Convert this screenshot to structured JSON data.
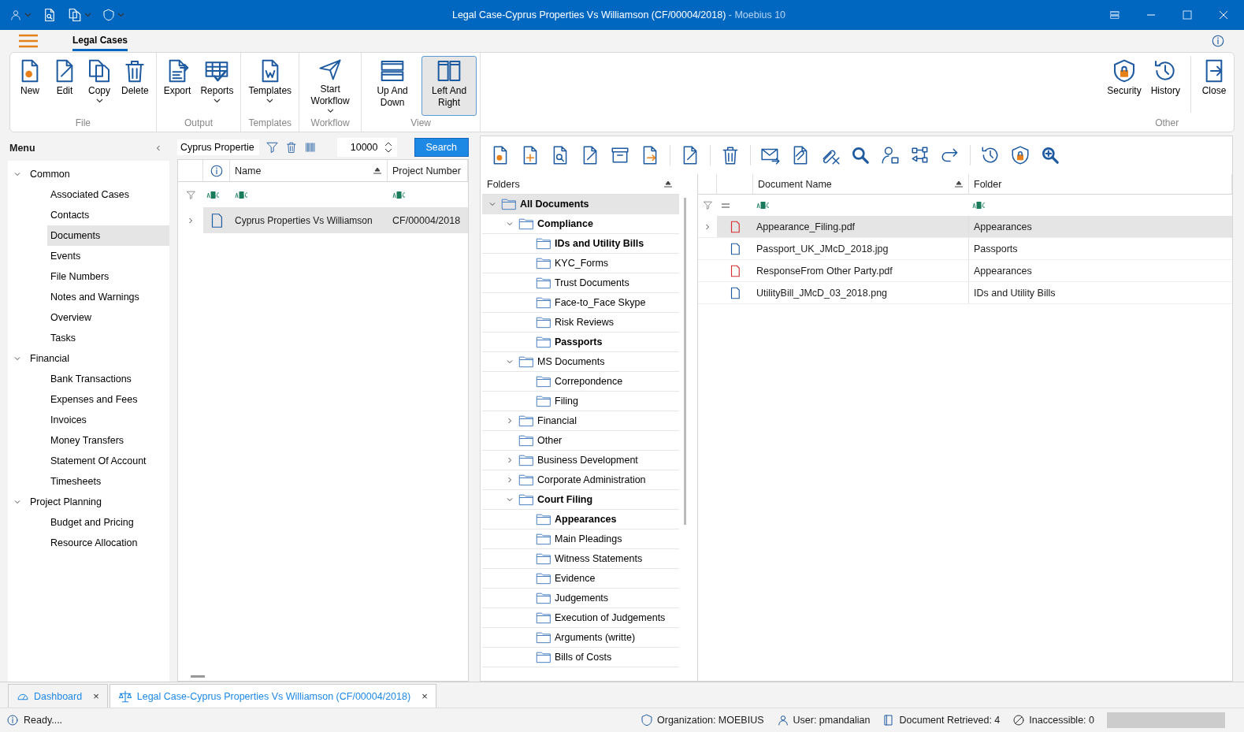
{
  "window": {
    "title": "Legal Case-Cyprus Properties Vs Williamson (CF/00004/2018)",
    "app_name": "- Moebius 10"
  },
  "ribbon": {
    "tabs": [
      {
        "label": "Legal Cases",
        "selected": true
      }
    ],
    "groups": [
      {
        "label": "File",
        "buttons": [
          {
            "label": "New",
            "dropdown": false,
            "selected": false
          },
          {
            "label": "Edit",
            "dropdown": false,
            "selected": false
          },
          {
            "label": "Copy",
            "dropdown": true,
            "selected": false
          },
          {
            "label": "Delete",
            "dropdown": false,
            "selected": false
          }
        ]
      },
      {
        "label": "Output",
        "buttons": [
          {
            "label": "Export",
            "dropdown": false,
            "selected": false
          },
          {
            "label": "Reports",
            "dropdown": true,
            "selected": false
          }
        ]
      },
      {
        "label": "Templates",
        "buttons": [
          {
            "label": "Templates",
            "dropdown": true,
            "selected": false
          }
        ]
      },
      {
        "label": "Workflow",
        "buttons": [
          {
            "label": "Start Workflow",
            "dropdown": true,
            "selected": false
          }
        ]
      },
      {
        "label": "View",
        "buttons": [
          {
            "label": "Up And Down",
            "dropdown": false,
            "selected": false
          },
          {
            "label": "Left And Right",
            "dropdown": false,
            "selected": true
          }
        ]
      }
    ],
    "right_group": {
      "label": "Other",
      "buttons": [
        {
          "label": "Security",
          "dropdown": false,
          "selected": false
        },
        {
          "label": "History",
          "dropdown": false,
          "selected": false
        },
        {
          "label": "Close",
          "dropdown": false,
          "selected": false
        }
      ]
    }
  },
  "menu": {
    "title": "Menu",
    "sections": [
      {
        "label": "Common",
        "expanded": true,
        "children": [
          {
            "label": "Associated Cases",
            "selected": false
          },
          {
            "label": "Contacts",
            "selected": false
          },
          {
            "label": "Documents",
            "selected": true
          },
          {
            "label": "Events",
            "selected": false
          },
          {
            "label": "File Numbers",
            "selected": false
          },
          {
            "label": "Notes and Warnings",
            "selected": false
          },
          {
            "label": "Overview",
            "selected": false
          },
          {
            "label": "Tasks",
            "selected": false
          }
        ]
      },
      {
        "label": "Financial",
        "expanded": true,
        "children": [
          {
            "label": "Bank Transactions",
            "selected": false
          },
          {
            "label": "Expenses and Fees",
            "selected": false
          },
          {
            "label": "Invoices",
            "selected": false
          },
          {
            "label": "Money Transfers",
            "selected": false
          },
          {
            "label": "Statement Of Account",
            "selected": false
          },
          {
            "label": "Timesheets",
            "selected": false
          }
        ]
      },
      {
        "label": "Project Planning",
        "expanded": true,
        "children": [
          {
            "label": "Budget and Pricing",
            "selected": false
          },
          {
            "label": "Resource Allocation",
            "selected": false
          }
        ]
      }
    ]
  },
  "case_list": {
    "filter": "Cyprus Propertie",
    "count": "10000",
    "search_button": "Search",
    "columns": [
      "Name",
      "Project Number"
    ],
    "rows": [
      {
        "name": "Cyprus Properties Vs Williamson",
        "project_number": "CF/00004/2018",
        "selected": true
      }
    ]
  },
  "documents": {
    "folders_header": "Folders",
    "tree": [
      {
        "label": "All Documents",
        "bold": true,
        "expanded": true,
        "selected": true,
        "children": [
          {
            "label": "Compliance",
            "bold": true,
            "expanded": true,
            "selected": false,
            "children": [
              {
                "label": "IDs and Utility Bills",
                "bold": true,
                "selected": false
              },
              {
                "label": "KYC_Forms",
                "bold": false,
                "selected": false
              },
              {
                "label": "Trust Documents",
                "bold": false,
                "selected": false
              },
              {
                "label": "Face-to_Face Skype",
                "bold": false,
                "selected": false
              },
              {
                "label": "Risk Reviews",
                "bold": false,
                "selected": false
              },
              {
                "label": "Passports",
                "bold": true,
                "selected": false
              }
            ]
          },
          {
            "label": "MS Documents",
            "bold": false,
            "expanded": true,
            "selected": false,
            "children": [
              {
                "label": "Correpondence",
                "bold": false,
                "selected": false
              },
              {
                "label": "Filing",
                "bold": false,
                "selected": false
              }
            ]
          },
          {
            "label": "Financial",
            "bold": false,
            "expanded": false,
            "selected": false
          },
          {
            "label": "Other",
            "bold": false,
            "selected": false
          },
          {
            "label": "Business Development",
            "bold": false,
            "expanded": false,
            "selected": false
          },
          {
            "label": "Corporate Administration",
            "bold": false,
            "expanded": false,
            "selected": false
          },
          {
            "label": "Court Filing",
            "bold": true,
            "expanded": true,
            "selected": false,
            "children": [
              {
                "label": "Appearances",
                "bold": true,
                "selected": false
              },
              {
                "label": "Main Pleadings",
                "bold": false,
                "selected": false
              },
              {
                "label": "Witness Statements",
                "bold": false,
                "selected": false
              },
              {
                "label": "Evidence",
                "bold": false,
                "selected": false
              },
              {
                "label": "Judgements",
                "bold": false,
                "selected": false
              },
              {
                "label": "Execution of Judgements",
                "bold": false,
                "selected": false
              },
              {
                "label": "Arguments (writte)",
                "bold": false,
                "selected": false
              },
              {
                "label": "Bills of Costs",
                "bold": false,
                "selected": false
              }
            ]
          }
        ]
      }
    ],
    "columns": [
      "Document Name",
      "Folder"
    ],
    "rows": [
      {
        "name": "Appearance_Filing.pdf",
        "folder": "Appearances",
        "kind": "pdf",
        "selected": true
      },
      {
        "name": "Passport_UK_JMcD_2018.jpg",
        "folder": "Passports",
        "kind": "image",
        "selected": false
      },
      {
        "name": "ResponseFrom Other Party.pdf",
        "folder": "Appearances",
        "kind": "pdf",
        "selected": false
      },
      {
        "name": "UtilityBill_JMcD_03_2018.png",
        "folder": "IDs and Utility Bills",
        "kind": "image",
        "selected": false
      }
    ]
  },
  "open_tabs": [
    {
      "label": "Dashboard",
      "kind": "dashboard",
      "selected": false,
      "close": "×"
    },
    {
      "label": "Legal Case-Cyprus Properties Vs Williamson (CF/00004/2018)",
      "kind": "case",
      "selected": true,
      "close": "×"
    }
  ],
  "status_bar": {
    "message": "Ready....",
    "items": [
      {
        "kind": "organization",
        "text": "Organization: MOEBIUS"
      },
      {
        "kind": "user",
        "text": "User: pmandalian"
      },
      {
        "kind": "documents",
        "text": "Document Retrieved: 4"
      },
      {
        "kind": "inaccessible",
        "text": "Inaccessible: 0"
      }
    ]
  }
}
